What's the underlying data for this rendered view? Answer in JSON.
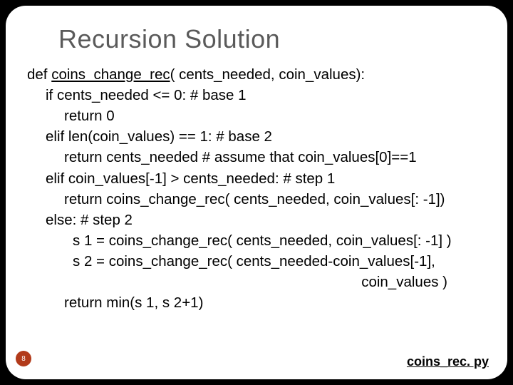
{
  "title": "Recursion Solution",
  "code": {
    "l1_pre": "def ",
    "l1_fn": "coins_change_rec",
    "l1_post": "( cents_needed,  coin_values):",
    "l2": "if cents_needed <= 0: # base 1",
    "l3": "return 0",
    "l4": "elif len(coin_values) == 1: # base 2",
    "l5": "return cents_needed  # assume that coin_values[0]==1",
    "l6": "elif coin_values[-1] > cents_needed: # step 1",
    "l7": "return coins_change_rec( cents_needed, coin_values[: -1])",
    "l8": "else: # step 2",
    "l9": "s 1 = coins_change_rec( cents_needed, coin_values[: -1] )",
    "l10": "s 2 = coins_change_rec( cents_needed-coin_values[-1],",
    "l11": "coin_values )",
    "l12": "return min(s 1, s 2+1)"
  },
  "page_number": "8",
  "file_link": "coins_rec. py"
}
